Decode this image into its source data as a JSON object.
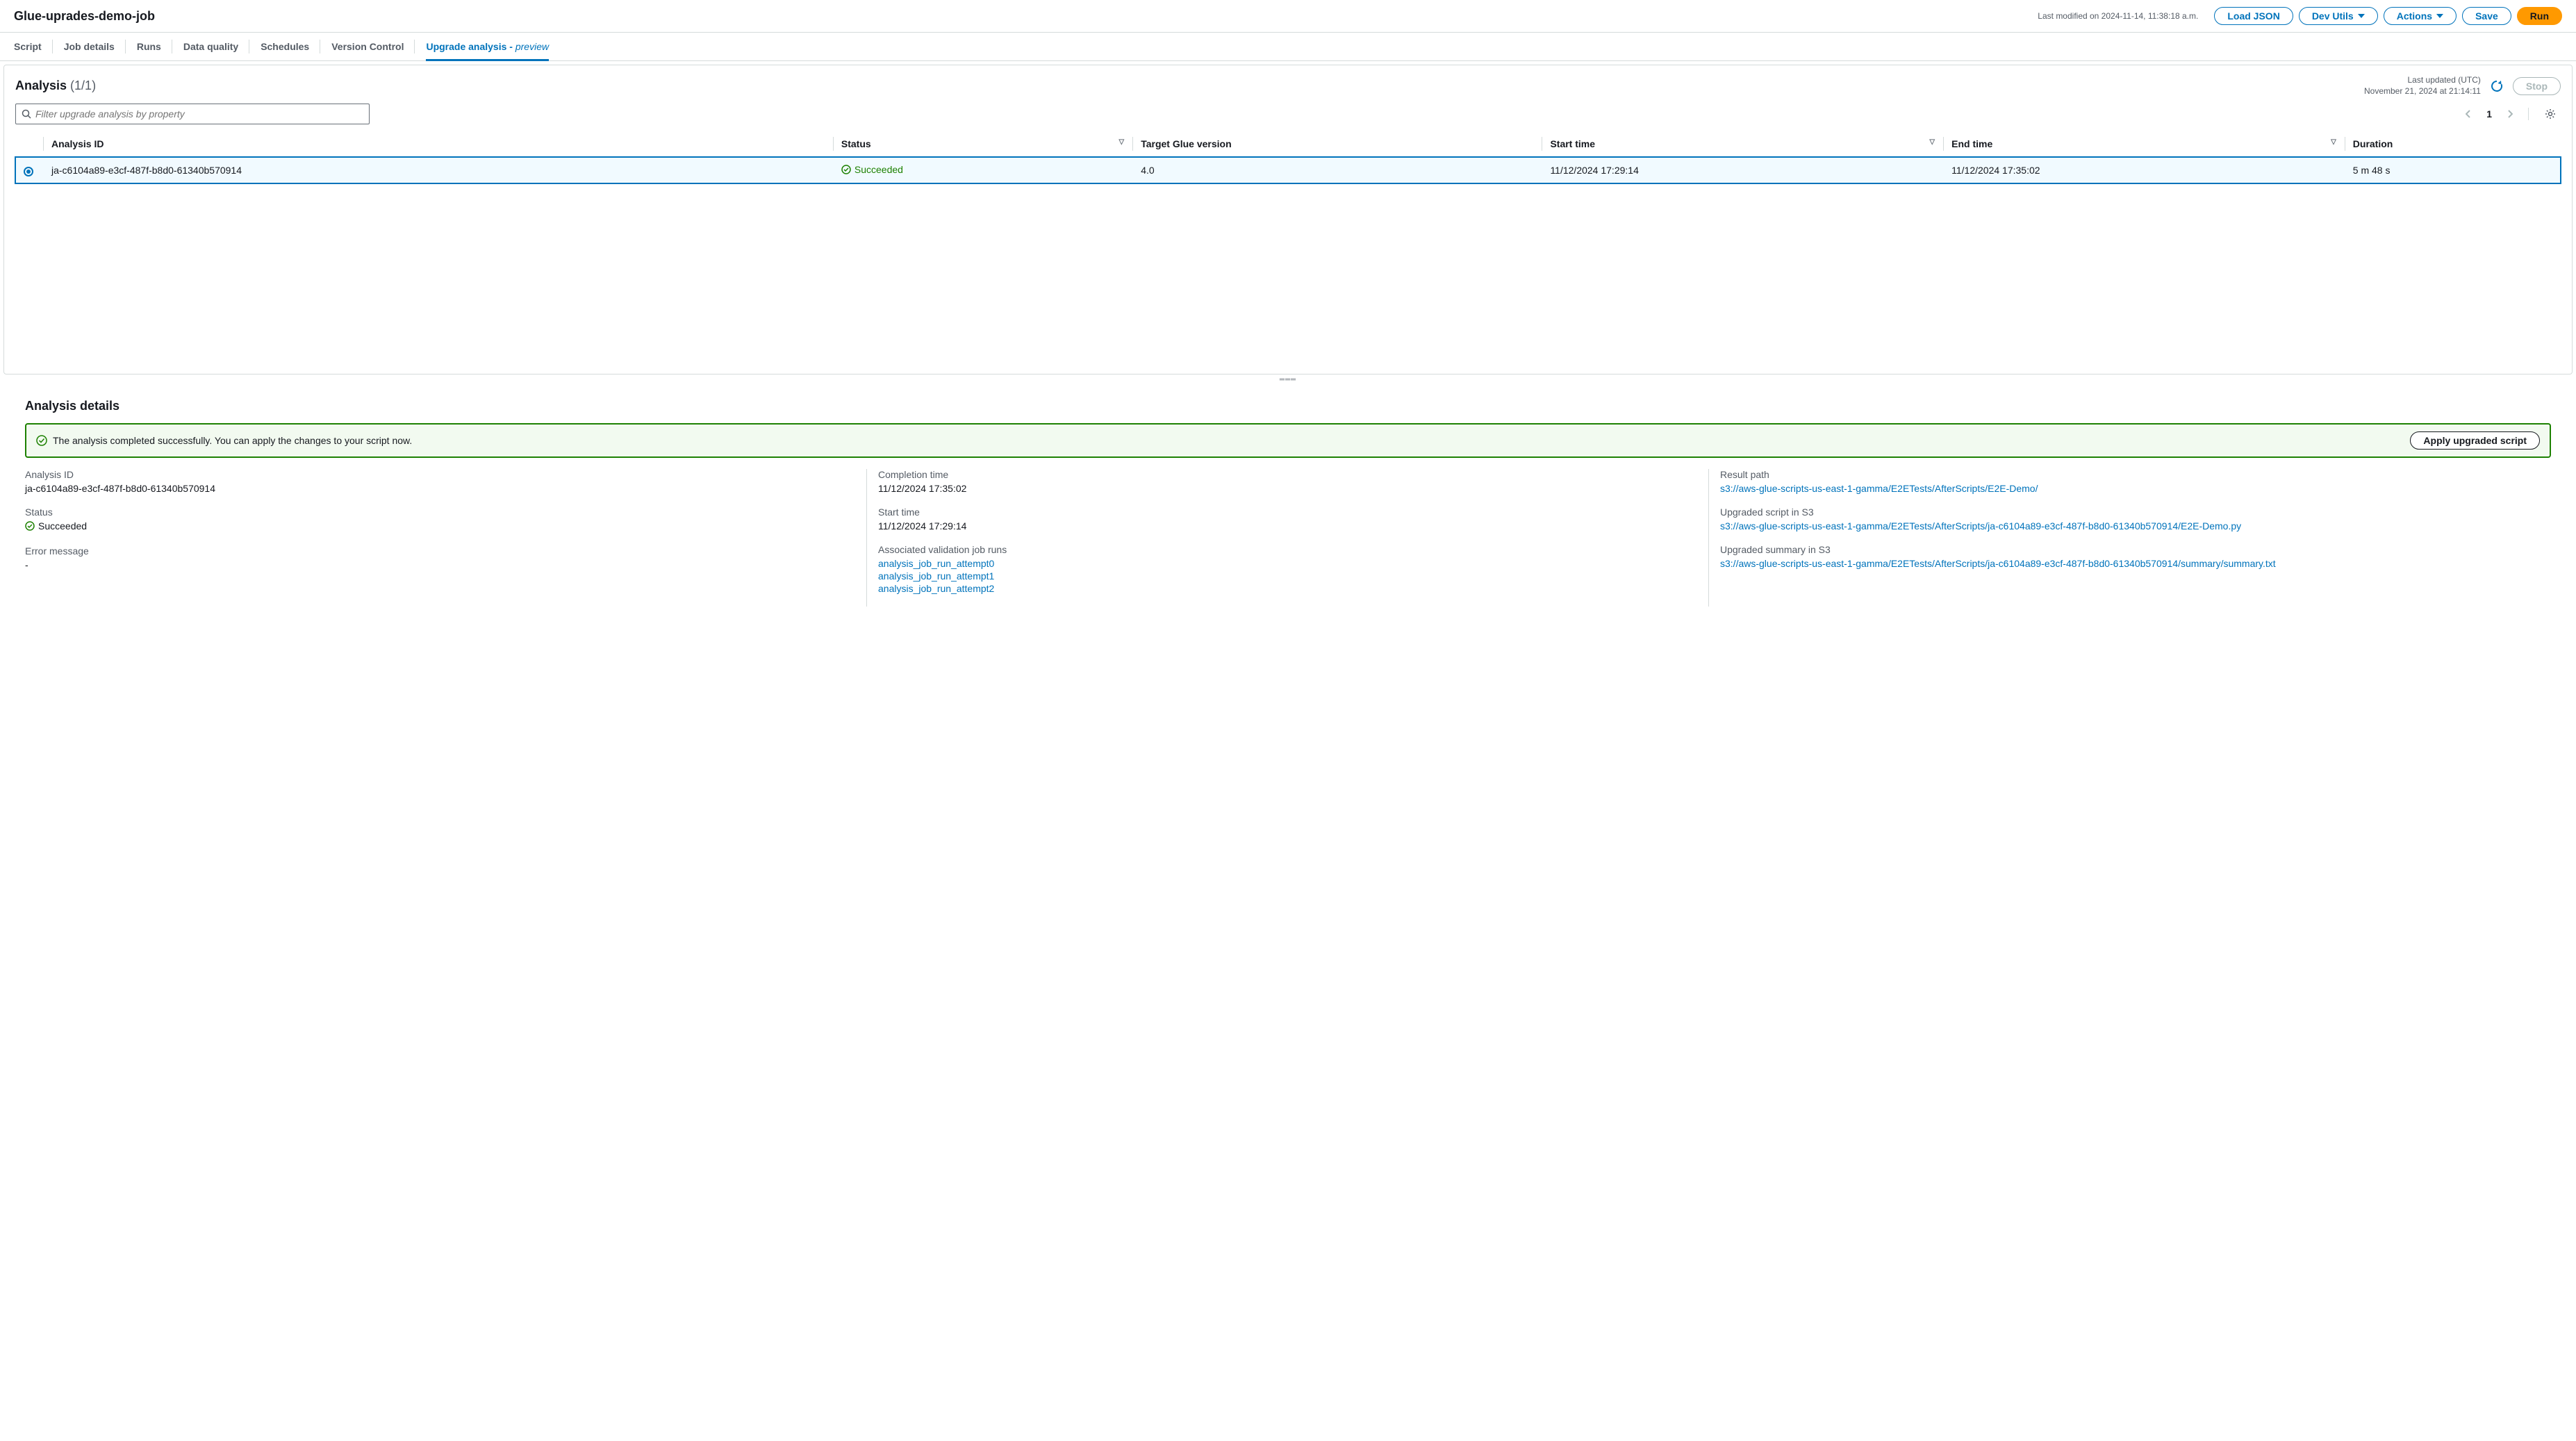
{
  "header": {
    "jobTitle": "Glue-uprades-demo-job",
    "lastModified": "Last modified on 2024-11-14, 11:38:18 a.m.",
    "loadJson": "Load JSON",
    "devUtils": "Dev Utils",
    "actions": "Actions",
    "save": "Save",
    "run": "Run"
  },
  "tabs": {
    "script": "Script",
    "jobDetails": "Job details",
    "runs": "Runs",
    "dataQuality": "Data quality",
    "schedules": "Schedules",
    "versionControl": "Version Control",
    "upgradeAnalysis": "Upgrade analysis - ",
    "preview": "preview"
  },
  "analysis": {
    "title": "Analysis ",
    "count": "(1/1)",
    "lastUpdatedLabel": "Last updated (UTC)",
    "lastUpdatedValue": "November 21, 2024 at 21:14:11",
    "stop": "Stop",
    "searchPlaceholder": "Filter upgrade analysis by property",
    "page": "1",
    "cols": {
      "analysisId": "Analysis ID",
      "status": "Status",
      "targetGlueVersion": "Target Glue version",
      "startTime": "Start time",
      "endTime": "End time",
      "duration": "Duration"
    },
    "row": {
      "id": "ja-c6104a89-e3cf-487f-b8d0-61340b570914",
      "status": "Succeeded",
      "target": "4.0",
      "start": "11/12/2024 17:29:14",
      "end": "11/12/2024 17:35:02",
      "duration": "5 m 48 s"
    }
  },
  "details": {
    "title": "Analysis details",
    "alert": "The analysis completed successfully. You can apply the changes to your script now.",
    "applyBtn": "Apply upgraded script",
    "labels": {
      "analysisId": "Analysis ID",
      "status": "Status",
      "errorMessage": "Error message",
      "completionTime": "Completion time",
      "startTime": "Start time",
      "associatedRuns": "Associated validation job runs",
      "resultPath": "Result path",
      "upgradedScript": "Upgraded script in S3",
      "upgradedSummary": "Upgraded summary in S3"
    },
    "values": {
      "analysisId": "ja-c6104a89-e3cf-487f-b8d0-61340b570914",
      "status": "Succeeded",
      "errorMessage": "-",
      "completionTime": "11/12/2024 17:35:02",
      "startTime": "11/12/2024 17:29:14",
      "run0": "analysis_job_run_attempt0",
      "run1": "analysis_job_run_attempt1",
      "run2": "analysis_job_run_attempt2",
      "resultPath": "s3://aws-glue-scripts-us-east-1-gamma/E2ETests/AfterScripts/E2E-Demo/",
      "upgradedScript": "s3://aws-glue-scripts-us-east-1-gamma/E2ETests/AfterScripts/ja-c6104a89-e3cf-487f-b8d0-61340b570914/E2E-Demo.py",
      "upgradedSummary": "s3://aws-glue-scripts-us-east-1-gamma/E2ETests/AfterScripts/ja-c6104a89-e3cf-487f-b8d0-61340b570914/summary/summary.txt"
    }
  }
}
